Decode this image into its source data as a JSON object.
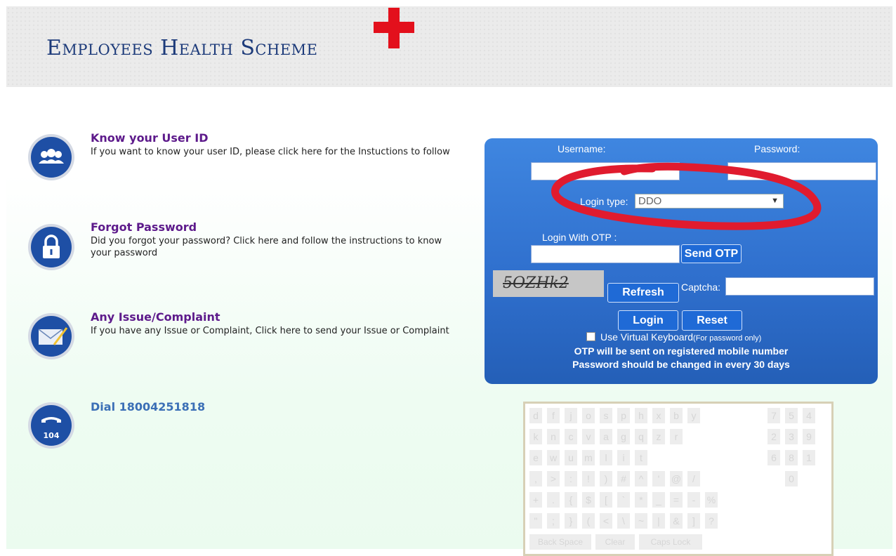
{
  "header": {
    "title": "Employees Health Scheme"
  },
  "info": {
    "items": [
      {
        "title": "Know your User ID",
        "desc": "If you want to know your user ID, please click here for the Instuctions to follow"
      },
      {
        "title": "Forgot Password",
        "desc": "Did you forgot your password? Click here and follow the instructions to know your password"
      },
      {
        "title": "Any Issue/Complaint",
        "desc": "If you have any Issue or Complaint, Click here to send your Issue or Complaint"
      }
    ],
    "dial_icon_label": "104",
    "dial": "Dial 18004251818"
  },
  "login": {
    "username_label": "Username:",
    "password_label": "Password:",
    "login_type_label": "Login type:",
    "login_type_value": "DDO",
    "otp_label": "Login With OTP :",
    "send_otp": "Send OTP",
    "captcha_text": "5OZHk2",
    "refresh": "Refresh",
    "captcha_label": "Captcha:",
    "login_btn": "Login",
    "reset_btn": "Reset",
    "virtual_kb_label": "Use Virtual Keyboard",
    "virtual_kb_note": "(For password only)",
    "note1": "OTP will be sent on registered mobile number",
    "note2": "Password should be changed in every 30 days"
  },
  "keyboard": {
    "rows": [
      [
        "d",
        "f",
        "j",
        "o",
        "s",
        "p",
        "h",
        "x",
        "b",
        "y"
      ],
      [
        "k",
        "n",
        "c",
        "v",
        "a",
        "g",
        "q",
        "z",
        "r"
      ],
      [
        "e",
        "w",
        "u",
        "m",
        "l",
        "i",
        "t"
      ],
      [
        ",",
        ">",
        ":",
        "!",
        ")",
        "#",
        "^",
        "'",
        "@",
        "/"
      ],
      [
        "+",
        ".",
        "{",
        "$",
        "[",
        "`",
        "*",
        "_",
        "=",
        "-",
        "%"
      ],
      [
        "\"",
        ";",
        "}",
        "(",
        "<",
        "\\",
        "~",
        "|",
        "&",
        "]",
        "?"
      ]
    ],
    "digits": [
      [
        "7",
        "5",
        "4"
      ],
      [
        "2",
        "3",
        "9"
      ],
      [
        "6",
        "8",
        "1"
      ],
      [
        "0"
      ]
    ],
    "back_space": "Back Space",
    "clear": "Clear",
    "caps_lock": "Caps Lock"
  }
}
